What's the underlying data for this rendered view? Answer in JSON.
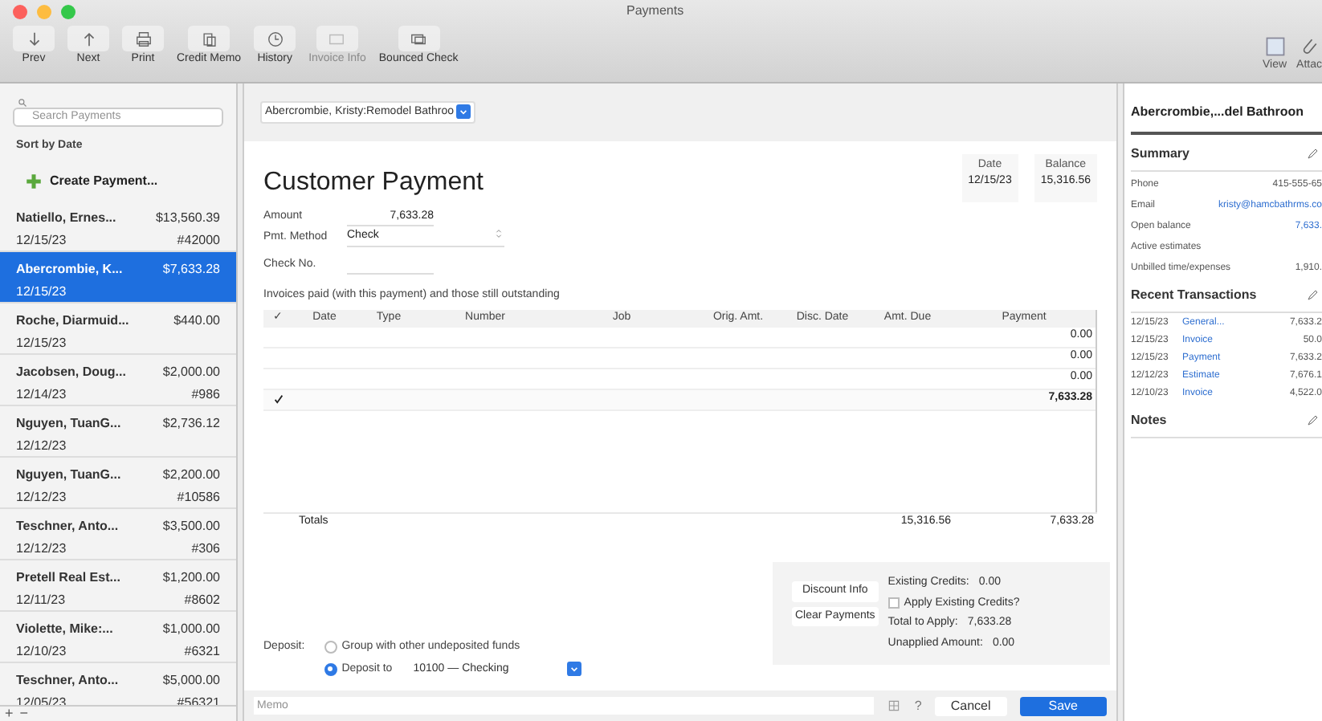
{
  "window": {
    "title": "Payments"
  },
  "toolbar": [
    {
      "label": "Prev",
      "disabled": false
    },
    {
      "label": "Next",
      "disabled": false
    },
    {
      "label": "Print",
      "disabled": false
    },
    {
      "label": "Credit Memo",
      "disabled": false
    },
    {
      "label": "History",
      "disabled": false
    },
    {
      "label": "Invoice Info",
      "disabled": true
    },
    {
      "label": "Bounced Check",
      "disabled": false
    }
  ],
  "toolbar_right": [
    {
      "label": "View"
    },
    {
      "label": "Attac"
    }
  ],
  "sidebar": {
    "search": {
      "placeholder": "Search Payments"
    },
    "sort": "Sort by Date",
    "create": "Create Payment...",
    "items": [
      {
        "name": "Natiello, Ernes...",
        "amount": "$13,560.39",
        "date": "12/15/23",
        "ref": "#42000",
        "selected": false
      },
      {
        "name": "Abercrombie, K...",
        "amount": "$7,633.28",
        "date": "12/15/23",
        "selected": true
      },
      {
        "name": "Roche, Diarmuid...",
        "amount": "$440.00",
        "date": "12/15/23",
        "selected": false
      },
      {
        "name": "Jacobsen, Doug...",
        "amount": "$2,000.00",
        "date": "12/14/23",
        "ref": "#986",
        "selected": false
      },
      {
        "name": "Nguyen, TuanG...",
        "amount": "$2,736.12",
        "date": "12/12/23",
        "selected": false
      },
      {
        "name": "Nguyen, TuanG...",
        "amount": "$2,200.00",
        "date": "12/12/23",
        "ref": "#10586",
        "selected": false
      },
      {
        "name": "Teschner, Anto...",
        "amount": "$3,500.00",
        "date": "12/12/23",
        "ref": "#306",
        "selected": false
      },
      {
        "name": "Pretell Real Est...",
        "amount": "$1,200.00",
        "date": "12/11/23",
        "ref": "#8602",
        "selected": false
      },
      {
        "name": "Violette, Mike:...",
        "amount": "$1,000.00",
        "date": "12/10/23",
        "ref": "#6321",
        "selected": false
      },
      {
        "name": "Teschner, Anto...",
        "amount": "$5,000.00",
        "date": "12/05/23",
        "ref": "#56321",
        "selected": false
      }
    ],
    "footer": {
      "add": "+",
      "remove": "−"
    }
  },
  "form": {
    "customer": "Abercrombie, Kristy:Remodel Bathroo",
    "title": "Customer Payment",
    "date_label": "Date",
    "date": "12/15/23",
    "balance_label": "Balance",
    "balance": "15,316.56",
    "amount_label": "Amount",
    "amount": "7,633.28",
    "method_label": "Pmt. Method",
    "method": "Check",
    "check_label": "Check No.",
    "caption": "Invoices paid (with this payment) and those still outstanding",
    "columns": [
      "✓",
      "Date",
      "Type",
      "Number",
      "Job",
      "Orig. Amt.",
      "Disc. Date",
      "Amt. Due",
      "Payment"
    ],
    "rows": [
      {
        "checked": false,
        "payment": "0.00"
      },
      {
        "checked": false,
        "payment": "0.00"
      },
      {
        "checked": false,
        "payment": "0.00"
      },
      {
        "checked": true,
        "payment": "7,633.28"
      }
    ],
    "totals_label": "Totals",
    "total_due": "15,316.56",
    "total_payment": "7,633.28",
    "deposit_label": "Deposit:",
    "group_label": "Group with other undeposited funds",
    "group_selected": false,
    "deposit_to_label": "Deposit to",
    "deposit_to_selected": true,
    "account": "10100 — Checking",
    "discount_button": "Discount Info",
    "clear_button": "Clear Payments",
    "credits": [
      {
        "label": "Existing Credits:",
        "value": "0.00"
      },
      {
        "label": "Total to Apply:",
        "value": "7,633.28"
      },
      {
        "label": "Unapplied Amount:",
        "value": "0.00"
      }
    ],
    "apply_credits": {
      "label": "Apply Existing Credits?",
      "checked": false
    },
    "memo": {
      "placeholder": "Memo"
    },
    "help": "?",
    "cancel": "Cancel",
    "save": "Save"
  },
  "panel": {
    "title": "Abercrombie,...del Bathroon",
    "summary_title": "Summary",
    "summary": [
      {
        "label": "Phone",
        "value": "415-555-65",
        "link": false
      },
      {
        "label": "Email",
        "value": "kristy@hamcbathrms.co",
        "link": true
      },
      {
        "label": "Open balance",
        "value": "7,633.",
        "link": true
      },
      {
        "label": "Active estimates",
        "link": false
      },
      {
        "label": "Unbilled time/expenses",
        "value": "1,910.",
        "link": false
      }
    ],
    "recent_title": "Recent Transactions",
    "recent": [
      {
        "date": "12/15/23",
        "type": "General...",
        "amount": "7,633.2"
      },
      {
        "date": "12/15/23",
        "type": "Invoice",
        "amount": "50.0"
      },
      {
        "date": "12/15/23",
        "type": "Payment",
        "amount": "7,633.2"
      },
      {
        "date": "12/12/23",
        "type": "Estimate",
        "amount": "7,676.1"
      },
      {
        "date": "12/10/23",
        "type": "Invoice",
        "amount": "4,522.0"
      }
    ],
    "notes_title": "Notes"
  }
}
